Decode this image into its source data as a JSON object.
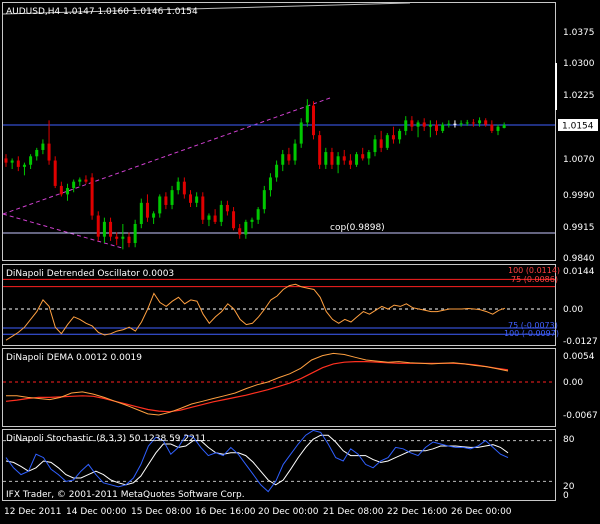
{
  "colors": {
    "background": "#000000",
    "frame": "#c8c8c8",
    "text": "#ffffff",
    "bull_candle": "#00c800",
    "bear_candle": "#e00000",
    "doji": "#ffffff",
    "blue_line": "#4060ff",
    "red_line": "#ff2020",
    "magenta_dash": "#d040d0",
    "orange_line": "#ffa040",
    "dema_red": "#ff3020",
    "stoch_blue": "#3060ff",
    "stoch_white": "#ffffff"
  },
  "main": {
    "header": "AUDUSD,H4  1.0147 1.0160 1.0146 1.0154",
    "price_labels": [
      "1.0375",
      "1.0300",
      "1.0225",
      "1.0154",
      "1.0070",
      "0.9990",
      "0.9915",
      "0.9840"
    ],
    "current_price": "1.0154",
    "cop_label": "cop(0.9898)",
    "candles": [
      {
        "o": 1.0075,
        "h": 1.0085,
        "l": 1.0055,
        "c": 1.0065
      },
      {
        "o": 1.0065,
        "h": 1.0075,
        "l": 1.005,
        "c": 1.007
      },
      {
        "o": 1.007,
        "h": 1.008,
        "l": 1.0045,
        "c": 1.0055
      },
      {
        "o": 1.0055,
        "h": 1.0065,
        "l": 1.0035,
        "c": 1.006
      },
      {
        "o": 1.006,
        "h": 1.0085,
        "l": 1.005,
        "c": 1.008
      },
      {
        "o": 1.008,
        "h": 1.01,
        "l": 1.007,
        "c": 1.0095
      },
      {
        "o": 1.0095,
        "h": 1.012,
        "l": 1.0085,
        "c": 1.011
      },
      {
        "o": 1.011,
        "h": 1.0165,
        "l": 1.006,
        "c": 1.007
      },
      {
        "o": 1.007,
        "h": 1.008,
        "l": 1.0005,
        "c": 1.001
      },
      {
        "o": 1.001,
        "h": 1.002,
        "l": 0.9985,
        "c": 0.999
      },
      {
        "o": 0.999,
        "h": 1.0015,
        "l": 0.9975,
        "c": 1.0005
      },
      {
        "o": 1.0005,
        "h": 1.0025,
        "l": 0.9995,
        "c": 1.002
      },
      {
        "o": 1.002,
        "h": 1.003,
        "l": 1.001,
        "c": 1.0025
      },
      {
        "o": 1.0025,
        "h": 1.0035,
        "l": 1.0015,
        "c": 1.002
      },
      {
        "o": 1.003,
        "h": 1.004,
        "l": 0.993,
        "c": 0.994
      },
      {
        "o": 0.994,
        "h": 0.995,
        "l": 0.988,
        "c": 0.989
      },
      {
        "o": 0.989,
        "h": 0.9935,
        "l": 0.9875,
        "c": 0.9925
      },
      {
        "o": 0.9925,
        "h": 0.9935,
        "l": 0.988,
        "c": 0.989
      },
      {
        "o": 0.989,
        "h": 0.99,
        "l": 0.987,
        "c": 0.9885
      },
      {
        "o": 0.9885,
        "h": 0.992,
        "l": 0.986,
        "c": 0.989
      },
      {
        "o": 0.989,
        "h": 0.99,
        "l": 0.9865,
        "c": 0.9875
      },
      {
        "o": 0.9875,
        "h": 0.993,
        "l": 0.9865,
        "c": 0.992
      },
      {
        "o": 0.992,
        "h": 0.998,
        "l": 0.991,
        "c": 0.997
      },
      {
        "o": 0.997,
        "h": 0.999,
        "l": 0.9925,
        "c": 0.9935
      },
      {
        "o": 0.9935,
        "h": 0.995,
        "l": 0.992,
        "c": 0.9945
      },
      {
        "o": 0.9945,
        "h": 0.999,
        "l": 0.9935,
        "c": 0.9985
      },
      {
        "o": 0.9985,
        "h": 0.9995,
        "l": 0.9955,
        "c": 0.9965
      },
      {
        "o": 0.9965,
        "h": 1.001,
        "l": 0.9955,
        "c": 1.0
      },
      {
        "o": 1.0,
        "h": 1.003,
        "l": 0.999,
        "c": 1.002
      },
      {
        "o": 1.002,
        "h": 1.003,
        "l": 0.998,
        "c": 0.999
      },
      {
        "o": 0.999,
        "h": 1.0,
        "l": 0.996,
        "c": 0.997
      },
      {
        "o": 0.997,
        "h": 0.9995,
        "l": 0.996,
        "c": 0.9985
      },
      {
        "o": 0.9985,
        "h": 0.9995,
        "l": 0.992,
        "c": 0.993
      },
      {
        "o": 0.993,
        "h": 0.9945,
        "l": 0.9915,
        "c": 0.994
      },
      {
        "o": 0.994,
        "h": 0.9955,
        "l": 0.992,
        "c": 0.9925
      },
      {
        "o": 0.9925,
        "h": 0.9975,
        "l": 0.9915,
        "c": 0.9965
      },
      {
        "o": 0.9965,
        "h": 0.9975,
        "l": 0.994,
        "c": 0.995
      },
      {
        "o": 0.995,
        "h": 0.996,
        "l": 0.9905,
        "c": 0.991
      },
      {
        "o": 0.991,
        "h": 0.992,
        "l": 0.9885,
        "c": 0.9895
      },
      {
        "o": 0.9895,
        "h": 0.993,
        "l": 0.9885,
        "c": 0.9925
      },
      {
        "o": 0.9925,
        "h": 0.9935,
        "l": 0.991,
        "c": 0.993
      },
      {
        "o": 0.993,
        "h": 0.996,
        "l": 0.992,
        "c": 0.9955
      },
      {
        "o": 0.9955,
        "h": 1.001,
        "l": 0.9945,
        "c": 1.0
      },
      {
        "o": 1.0,
        "h": 1.004,
        "l": 0.9985,
        "c": 1.003
      },
      {
        "o": 1.003,
        "h": 1.007,
        "l": 1.002,
        "c": 1.006
      },
      {
        "o": 1.006,
        "h": 1.0095,
        "l": 1.0045,
        "c": 1.0085
      },
      {
        "o": 1.0085,
        "h": 1.01,
        "l": 1.006,
        "c": 1.007
      },
      {
        "o": 1.007,
        "h": 1.012,
        "l": 1.006,
        "c": 1.011
      },
      {
        "o": 1.011,
        "h": 1.017,
        "l": 1.01,
        "c": 1.016
      },
      {
        "o": 1.016,
        "h": 1.0215,
        "l": 1.015,
        "c": 1.02
      },
      {
        "o": 1.02,
        "h": 1.021,
        "l": 1.012,
        "c": 1.013
      },
      {
        "o": 1.013,
        "h": 1.014,
        "l": 1.005,
        "c": 1.006
      },
      {
        "o": 1.006,
        "h": 1.01,
        "l": 1.005,
        "c": 1.009
      },
      {
        "o": 1.009,
        "h": 1.01,
        "l": 1.005,
        "c": 1.006
      },
      {
        "o": 1.006,
        "h": 1.009,
        "l": 1.004,
        "c": 1.008
      },
      {
        "o": 1.008,
        "h": 1.0095,
        "l": 1.006,
        "c": 1.007
      },
      {
        "o": 1.007,
        "h": 1.0085,
        "l": 1.005,
        "c": 1.006
      },
      {
        "o": 1.006,
        "h": 1.009,
        "l": 1.0055,
        "c": 1.0085
      },
      {
        "o": 1.0085,
        "h": 1.01,
        "l": 1.007,
        "c": 1.0075
      },
      {
        "o": 1.0075,
        "h": 1.0095,
        "l": 1.006,
        "c": 1.009
      },
      {
        "o": 1.009,
        "h": 1.013,
        "l": 1.008,
        "c": 1.012
      },
      {
        "o": 1.012,
        "h": 1.014,
        "l": 1.009,
        "c": 1.01
      },
      {
        "o": 1.01,
        "h": 1.0135,
        "l": 1.0095,
        "c": 1.013
      },
      {
        "o": 1.013,
        "h": 1.015,
        "l": 1.011,
        "c": 1.012
      },
      {
        "o": 1.012,
        "h": 1.0145,
        "l": 1.011,
        "c": 1.014
      },
      {
        "o": 1.014,
        "h": 1.0175,
        "l": 1.013,
        "c": 1.0165
      },
      {
        "o": 1.0165,
        "h": 1.0175,
        "l": 1.014,
        "c": 1.015
      },
      {
        "o": 1.015,
        "h": 1.0165,
        "l": 1.0125,
        "c": 1.016
      },
      {
        "o": 1.016,
        "h": 1.017,
        "l": 1.014,
        "c": 1.015
      },
      {
        "o": 1.015,
        "h": 1.0165,
        "l": 1.0125,
        "c": 1.0155
      },
      {
        "o": 1.0155,
        "h": 1.0165,
        "l": 1.013,
        "c": 1.014
      },
      {
        "o": 1.014,
        "h": 1.016,
        "l": 1.0135,
        "c": 1.0155
      },
      {
        "o": 1.0155,
        "h": 1.0165,
        "l": 1.0148,
        "c": 1.0157
      },
      {
        "o": 1.0157,
        "h": 1.0165,
        "l": 1.0148,
        "c": 1.0157
      },
      {
        "o": 1.0157,
        "h": 1.0165,
        "l": 1.015,
        "c": 1.0158
      },
      {
        "o": 1.0158,
        "h": 1.0166,
        "l": 1.0152,
        "c": 1.016
      },
      {
        "o": 1.016,
        "h": 1.0168,
        "l": 1.015,
        "c": 1.0158
      },
      {
        "o": 1.0158,
        "h": 1.0172,
        "l": 1.015,
        "c": 1.0165
      },
      {
        "o": 1.0165,
        "h": 1.017,
        "l": 1.015,
        "c": 1.0155
      },
      {
        "o": 1.0155,
        "h": 1.0165,
        "l": 1.0135,
        "c": 1.014
      },
      {
        "o": 1.014,
        "h": 1.0155,
        "l": 1.013,
        "c": 1.015
      },
      {
        "o": 1.0147,
        "h": 1.016,
        "l": 1.0146,
        "c": 1.0154
      }
    ]
  },
  "detrended": {
    "header": "DiNapoli Detrended Oscillator  0.0003",
    "labels": [
      "100 (0.0114)",
      "75 (0.0086)",
      "0.0144",
      "0.00",
      "75 (-0.0073)",
      "100 (-0.0097)",
      "-0.0127"
    ],
    "values": [
      -0.012,
      -0.0105,
      -0.009,
      -0.007,
      -0.004,
      -0.001,
      0.0035,
      0.001,
      -0.007,
      -0.0095,
      -0.006,
      -0.003,
      -0.004,
      -0.0055,
      -0.0065,
      -0.009,
      -0.01,
      -0.0095,
      -0.0085,
      -0.008,
      -0.007,
      -0.0085,
      -0.005,
      0.0,
      0.006,
      0.0025,
      0.001,
      0.003,
      0.0045,
      0.002,
      0.0035,
      0.003,
      -0.002,
      -0.0055,
      -0.003,
      -0.001,
      0.002,
      0.0,
      -0.004,
      -0.006,
      -0.0055,
      -0.003,
      0.0,
      0.0035,
      0.005,
      0.0075,
      0.009,
      0.0095,
      0.0085,
      0.008,
      0.0075,
      0.0045,
      -0.001,
      -0.004,
      -0.0055,
      -0.004,
      -0.005,
      -0.003,
      -0.001,
      -0.002,
      -0.0005,
      0.001,
      0.0,
      0.0015,
      0.001,
      0.002,
      0.0005,
      0.0,
      -0.0005,
      -0.001,
      -0.001,
      -0.0005,
      0.0,
      0.0,
      0.0,
      0.0002,
      0.0,
      -0.0003,
      -0.001,
      -0.002,
      -0.0005,
      0.0003
    ]
  },
  "dema": {
    "header": "DiNapoli DEMA  0.0012 0.0019",
    "labels": [
      "0.0054",
      "0.00",
      "-0.0067"
    ],
    "fast": [
      -0.0025,
      -0.0025,
      -0.0028,
      -0.003,
      -0.0032,
      -0.0028,
      -0.002,
      -0.0018,
      -0.0022,
      -0.0028,
      -0.0035,
      -0.0042,
      -0.005,
      -0.0058,
      -0.006,
      -0.0055,
      -0.0048,
      -0.004,
      -0.0035,
      -0.003,
      -0.0025,
      -0.002,
      -0.0012,
      -0.0005,
      0.0,
      0.0008,
      0.0015,
      0.0025,
      0.004,
      0.0048,
      0.0052,
      0.005,
      0.0045,
      0.004,
      0.0038,
      0.0036,
      0.0037,
      0.0035,
      0.0034,
      0.0033,
      0.0034,
      0.0035,
      0.0033,
      0.003,
      0.0028,
      0.0024,
      0.002
    ],
    "slow": [
      -0.0035,
      -0.0033,
      -0.003,
      -0.0028,
      -0.0028,
      -0.0027,
      -0.0026,
      -0.0025,
      -0.0026,
      -0.003,
      -0.0035,
      -0.004,
      -0.0045,
      -0.005,
      -0.0053,
      -0.0054,
      -0.0051,
      -0.0046,
      -0.0041,
      -0.0036,
      -0.0032,
      -0.0028,
      -0.0024,
      -0.0019,
      -0.0014,
      -0.0008,
      -0.0002,
      0.0006,
      0.0016,
      0.0026,
      0.0033,
      0.0036,
      0.0037,
      0.0037,
      0.0036,
      0.0035,
      0.0034,
      0.0034,
      0.0034,
      0.0034,
      0.0034,
      0.0034,
      0.0033,
      0.0031,
      0.0028,
      0.0025,
      0.0022
    ]
  },
  "stochastic": {
    "header": "DiNapoli Stochastic (8,3,3) 50.1238 59.2211",
    "labels": [
      "80",
      "20",
      "0"
    ],
    "k": [
      55,
      40,
      30,
      35,
      60,
      55,
      38,
      30,
      20,
      22,
      35,
      45,
      30,
      18,
      15,
      12,
      15,
      25,
      45,
      72,
      85,
      80,
      60,
      70,
      88,
      85,
      70,
      58,
      62,
      58,
      70,
      60,
      45,
      30,
      15,
      5,
      20,
      45,
      60,
      75,
      88,
      95,
      92,
      75,
      55,
      50,
      68,
      60,
      45,
      40,
      50,
      55,
      70,
      68,
      62,
      58,
      70,
      78,
      75,
      72,
      70,
      70,
      68,
      72,
      80,
      70,
      60,
      55
    ],
    "d": [
      50,
      48,
      42,
      35,
      40,
      50,
      48,
      40,
      30,
      25,
      25,
      30,
      35,
      30,
      22,
      18,
      15,
      18,
      28,
      45,
      62,
      75,
      75,
      70,
      72,
      80,
      80,
      70,
      62,
      60,
      62,
      62,
      58,
      48,
      35,
      22,
      15,
      22,
      38,
      55,
      70,
      82,
      88,
      88,
      78,
      65,
      58,
      58,
      58,
      52,
      48,
      50,
      55,
      60,
      65,
      65,
      65,
      68,
      72,
      72,
      72,
      71,
      70,
      70,
      72,
      74,
      70,
      62
    ]
  },
  "footer": {
    "copyright": "IFX Trader, © 2001-2011 MetaQuotes Software Corp."
  },
  "time_axis": {
    "labels": [
      "12 Dec 2011",
      "14 Dec 00:00",
      "15 Dec 08:00",
      "16 Dec 16:00",
      "20 Dec 00:00",
      "21 Dec 08:00",
      "22 Dec 16:00",
      "26 Dec 00:00"
    ]
  }
}
